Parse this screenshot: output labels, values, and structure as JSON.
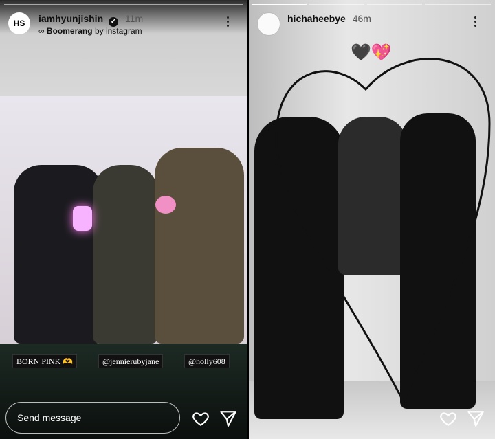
{
  "left_story": {
    "avatar_initials": "HS",
    "username": "iamhyunjishin",
    "time": "11m",
    "boomerang_label": "Boomerang",
    "by_label": "by instagram",
    "tags": [
      "BORN PINK 🫶",
      "@jennierubyjane",
      "@holly608"
    ],
    "message_placeholder": "Send message"
  },
  "right_story": {
    "username": "hichaheebye",
    "time": "46m",
    "emoji": "🖤💖"
  },
  "colors": {
    "bg_dark": "#0c0c0c",
    "text_light": "#ffffff"
  }
}
